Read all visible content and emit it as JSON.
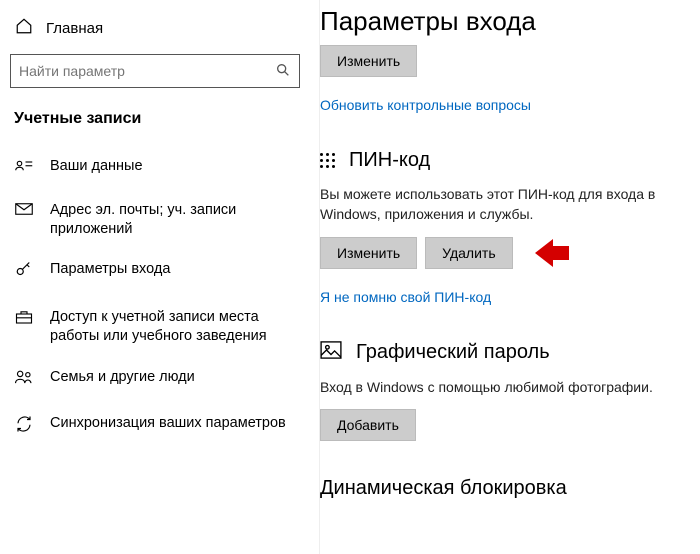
{
  "sidebar": {
    "home_label": "Главная",
    "search_placeholder": "Найти параметр",
    "section_header": "Учетные записи",
    "items": [
      {
        "label": "Ваши данные"
      },
      {
        "label": "Адрес эл. почты; уч. записи приложений"
      },
      {
        "label": "Параметры входа"
      },
      {
        "label": "Доступ к учетной записи места работы или учебного заведения"
      },
      {
        "label": "Семья и другие люди"
      },
      {
        "label": "Синхронизация ваших параметров"
      }
    ]
  },
  "main": {
    "title": "Параметры входа",
    "prev_button": "Изменить",
    "update_questions_link": "Обновить контрольные вопросы",
    "pin": {
      "header": "ПИН-код",
      "desc": "Вы можете использовать этот ПИН-код для входа в Windows, приложения и службы.",
      "change_btn": "Изменить",
      "delete_btn": "Удалить",
      "forgot_link": "Я не помню свой ПИН-код"
    },
    "picture": {
      "header": "Графический пароль",
      "desc": "Вход в Windows с помощью любимой фотографии.",
      "add_btn": "Добавить"
    },
    "dynamic_lock_header": "Динамическая блокировка"
  }
}
